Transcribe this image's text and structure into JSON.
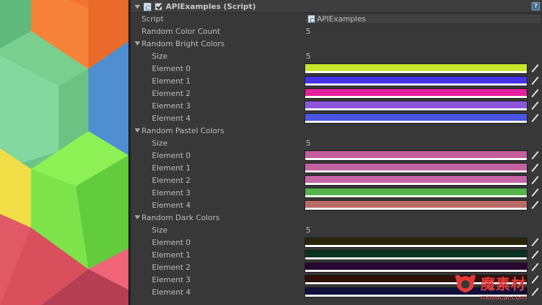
{
  "component": {
    "title": "APIExamples (Script)",
    "enabled": true,
    "help_icon": "help-icon"
  },
  "fields": {
    "script_label": "Script",
    "script_value": "APIExamples",
    "random_color_count_label": "Random Color Count",
    "random_color_count_value": "5"
  },
  "groups": [
    {
      "label": "Random Bright Colors",
      "size_label": "Size",
      "size_value": "5",
      "elements": [
        {
          "label": "Element 0",
          "color": "#c8e62c"
        },
        {
          "label": "Element 1",
          "color": "#4433e6"
        },
        {
          "label": "Element 2",
          "color": "#e61f9c"
        },
        {
          "label": "Element 3",
          "color": "#8c55dc"
        },
        {
          "label": "Element 4",
          "color": "#4a55e2"
        }
      ]
    },
    {
      "label": "Random Pastel Colors",
      "size_label": "Size",
      "size_value": "5",
      "elements": [
        {
          "label": "Element 0",
          "color": "#c45e9a"
        },
        {
          "label": "Element 1",
          "color": "#c262a2"
        },
        {
          "label": "Element 2",
          "color": "#c865a8"
        },
        {
          "label": "Element 3",
          "color": "#56b24c"
        },
        {
          "label": "Element 4",
          "color": "#b86a66"
        }
      ]
    },
    {
      "label": "Random Dark Colors",
      "size_label": "Size",
      "size_value": "5",
      "elements": [
        {
          "label": "Element 0",
          "color": "#2a2408"
        },
        {
          "label": "Element 1",
          "color": "#0a3322"
        },
        {
          "label": "Element 2",
          "color": "#2a0733"
        },
        {
          "label": "Element 3",
          "color": "#2e1008"
        },
        {
          "label": "Element 4",
          "color": "#10103a"
        }
      ]
    }
  ],
  "watermark": {
    "text": "魔素材",
    "sub": "mosucai.com"
  }
}
